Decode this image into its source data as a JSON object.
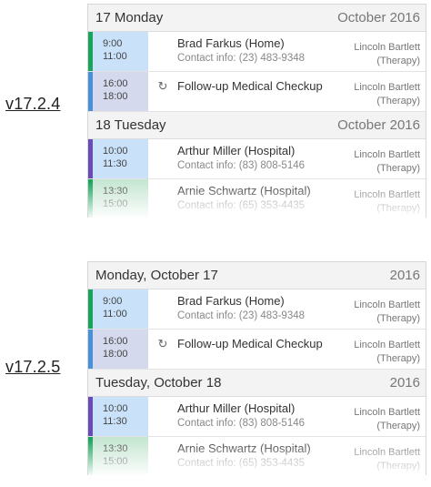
{
  "versions": [
    "v17.2.4",
    "v17.2.5"
  ],
  "colors": {
    "green": "#1aa35c",
    "blue": "#4a90d9",
    "purple": "#6a4bb6"
  },
  "panels": [
    {
      "days": [
        {
          "header_left": "17 Monday",
          "header_right": "October 2016",
          "events": [
            {
              "time": "9:00 11:00",
              "title": "Brad Farkus (Home)",
              "contact": "Contact info: (23) 483-9348",
              "who1": "Lincoln Bartlett",
              "who2": "(Therapy)"
            },
            {
              "time1": "16:00",
              "time2": "18:00",
              "icon": "recurring-icon",
              "title": "Follow-up Medical Checkup",
              "who1": "Lincoln Bartlett",
              "who2": "(Therapy)"
            }
          ]
        },
        {
          "header_left": "18 Tuesday",
          "header_right": "October 2016",
          "events": [
            {
              "time1": "10:00",
              "time2": "11:30",
              "title": "Arthur Miller (Hospital)",
              "contact": "Contact info: (83) 808-5146",
              "who1": "Lincoln Bartlett",
              "who2": "(Therapy)"
            },
            {
              "time1": "13:30",
              "time2": "15:00",
              "title": "Arnie Schwartz (Hospital)",
              "contact": "Contact info: (65) 353-4435",
              "who1": "Lincoln Bartlett",
              "who2": "(Therapy)"
            }
          ]
        }
      ]
    },
    {
      "days": [
        {
          "header_left": "Monday, October 17",
          "header_right": "2016",
          "events": [
            {
              "time": "9:00 11:00",
              "title": "Brad Farkus (Home)",
              "contact": "Contact info: (23) 483-9348",
              "who1": "Lincoln Bartlett",
              "who2": "(Therapy)"
            },
            {
              "time1": "16:00",
              "time2": "18:00",
              "icon": "recurring-icon",
              "title": "Follow-up Medical Checkup",
              "who1": "Lincoln Bartlett",
              "who2": "(Therapy)"
            }
          ]
        },
        {
          "header_left": "Tuesday, October 18",
          "header_right": "2016",
          "events": [
            {
              "time1": "10:00",
              "time2": "11:30",
              "title": "Arthur Miller (Hospital)",
              "contact": "Contact info: (83) 808-5146",
              "who1": "Lincoln Bartlett",
              "who2": "(Therapy)"
            },
            {
              "time1": "13:30",
              "time2": "15:00",
              "title": "Arnie Schwartz (Hospital)",
              "contact": "Contact info: (65) 353-4435",
              "who1": "Lincoln Bartlett",
              "who2": "(Therapy)"
            }
          ]
        }
      ]
    }
  ]
}
